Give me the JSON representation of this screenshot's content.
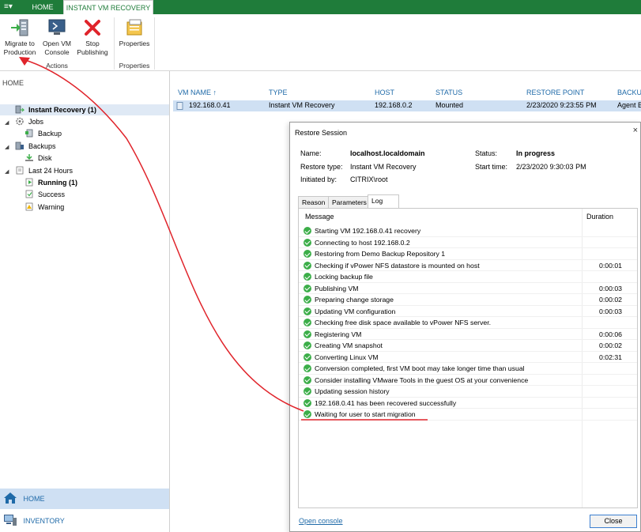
{
  "ribbon_tabs": {
    "menu": "≡▾",
    "home": "HOME",
    "active": "INSTANT VM RECOVERY"
  },
  "ribbon": {
    "migrate": "Migrate to\nProduction",
    "migrate_l1": "Migrate to",
    "migrate_l2": "Production",
    "open_console_l1": "Open VM",
    "open_console_l2": "Console",
    "stop_l1": "Stop",
    "stop_l2": "Publishing",
    "properties": "Properties",
    "group_actions": "Actions",
    "group_properties": "Properties"
  },
  "nav": {
    "home_title": "HOME",
    "tree": {
      "instant_recovery": "Instant Recovery (1)",
      "jobs": "Jobs",
      "backup": "Backup",
      "backups": "Backups",
      "disk": "Disk",
      "last24": "Last 24 Hours",
      "running": "Running (1)",
      "success": "Success",
      "warning": "Warning"
    },
    "bottom_home": "HOME",
    "bottom_inventory": "INVENTORY"
  },
  "grid": {
    "columns": [
      "VM NAME",
      "TYPE",
      "HOST",
      "STATUS",
      "RESTORE POINT",
      "BACKU"
    ],
    "row": {
      "vm_name": "192.168.0.41",
      "type": "Instant VM Recovery",
      "host": "192.168.0.2",
      "status": "Mounted",
      "restore_point": "2/23/2020 9:23:55 PM",
      "backup": "Agent B"
    }
  },
  "dialog": {
    "title": "Restore Session",
    "close_icon": "×",
    "name_label": "Name:",
    "name_value": "localhost.localdomain",
    "restore_type_label": "Restore type:",
    "restore_type_value": "Instant VM Recovery",
    "initiated_label": "Initiated by:",
    "initiated_value": "CITRIX\\root",
    "status_label": "Status:",
    "status_value": "In progress",
    "start_label": "Start time:",
    "start_value": "2/23/2020 9:30:03 PM",
    "tabs": [
      "Reason",
      "Parameters",
      "Log"
    ],
    "log_header_message": "Message",
    "log_header_duration": "Duration",
    "log": [
      {
        "msg": "Starting VM 192.168.0.41 recovery",
        "dur": ""
      },
      {
        "msg": "Connecting to host 192.168.0.2",
        "dur": ""
      },
      {
        "msg": "Restoring from Demo Backup Repository 1",
        "dur": ""
      },
      {
        "msg": "Checking if vPower NFS datastore is mounted on host",
        "dur": "0:00:01"
      },
      {
        "msg": "Locking backup file",
        "dur": ""
      },
      {
        "msg": "Publishing VM",
        "dur": "0:00:03"
      },
      {
        "msg": "Preparing change storage",
        "dur": "0:00:02"
      },
      {
        "msg": "Updating VM configuration",
        "dur": "0:00:03"
      },
      {
        "msg": "Checking free disk space available to vPower NFS server.",
        "dur": ""
      },
      {
        "msg": "Registering VM",
        "dur": "0:00:06"
      },
      {
        "msg": "Creating VM snapshot",
        "dur": "0:00:02"
      },
      {
        "msg": "Converting Linux VM",
        "dur": "0:02:31"
      },
      {
        "msg": "Conversion completed, first VM boot may take longer time than usual",
        "dur": ""
      },
      {
        "msg": "Consider installing VMware Tools in the guest OS at your convenience",
        "dur": ""
      },
      {
        "msg": "Updating session history",
        "dur": ""
      },
      {
        "msg": "192.168.0.41 has been recovered successfully",
        "dur": ""
      },
      {
        "msg": "Waiting for user to start migration",
        "dur": ""
      }
    ],
    "open_console": "Open console",
    "close_button": "Close"
  },
  "colors": {
    "accent_green": "#1f7c3a",
    "selection": "#cfe0f3",
    "link": "#1f6aa8",
    "annotation_red": "#e0242b",
    "ok_green": "#3cae49"
  }
}
